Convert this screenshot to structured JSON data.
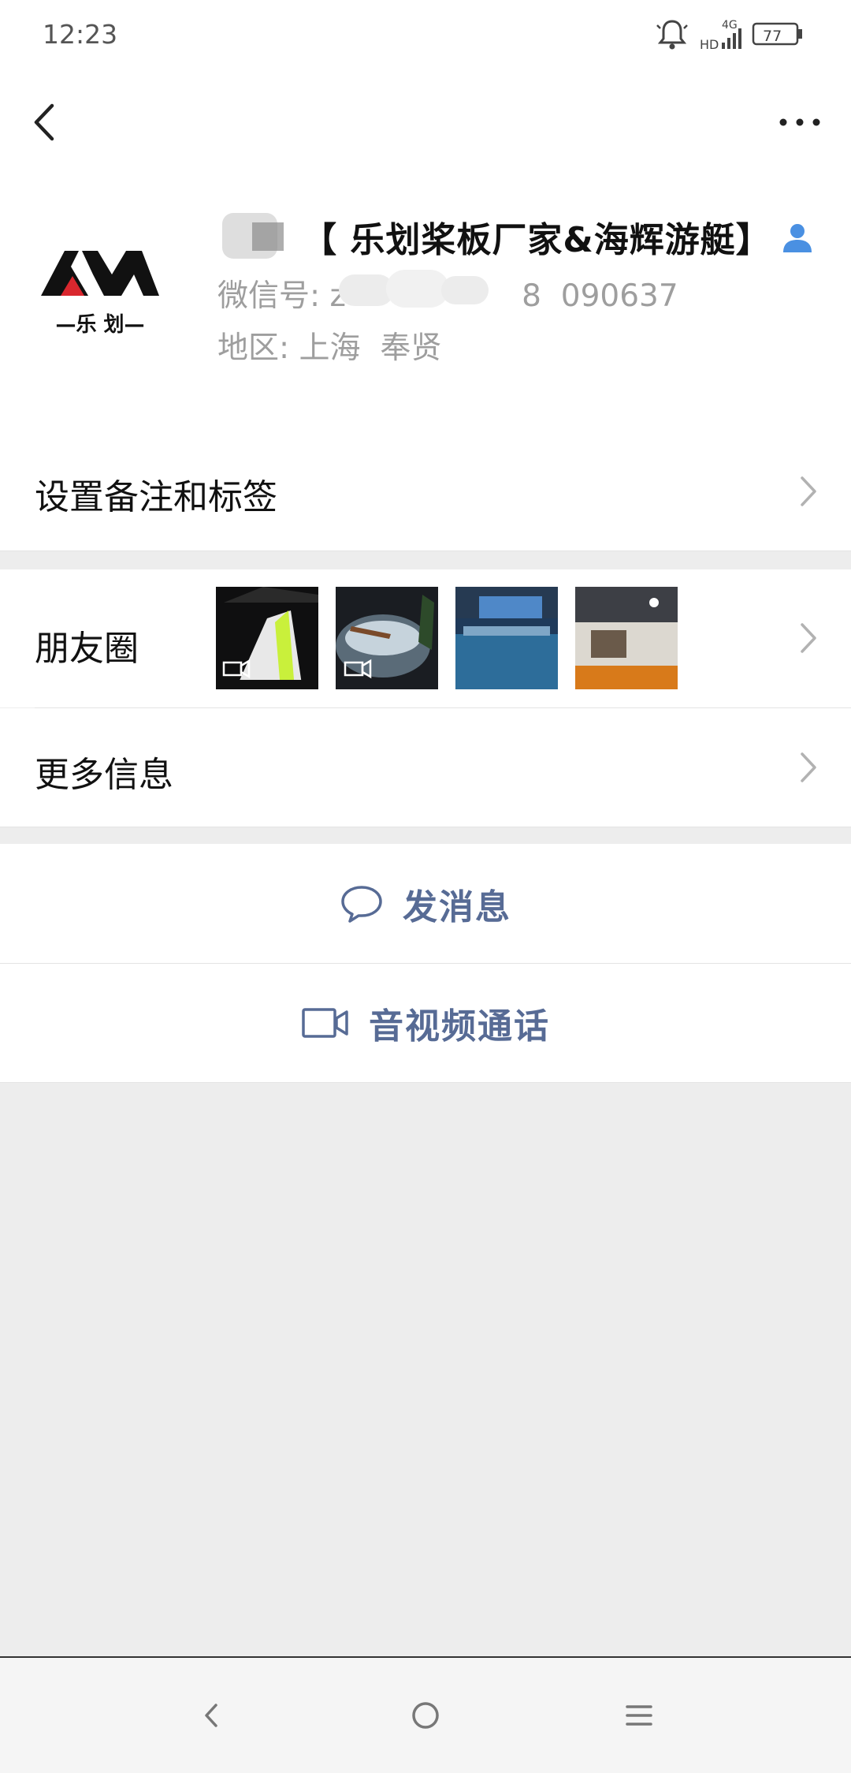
{
  "status_bar": {
    "time": "12:23",
    "network_hd": "HD",
    "network_type": "4G",
    "battery": "77"
  },
  "profile": {
    "name": "【 乐划桨板厂家&海辉游艇】",
    "wechat_id_label": "微信号: ",
    "wechat_id_value": "z                  8  090637",
    "region_label": "地区: ",
    "region_value": "上海  奉贤",
    "avatar_brand_text": "—乐 划—"
  },
  "cells": {
    "remark": "设置备注和标签",
    "moments": "朋友圈",
    "more_info": "更多信息"
  },
  "actions": {
    "send_message": "发消息",
    "video_call": "音视频通话"
  },
  "colors": {
    "link_blue": "#576b95",
    "person_icon_blue": "#4a90e2",
    "background_gray": "#ededed"
  }
}
